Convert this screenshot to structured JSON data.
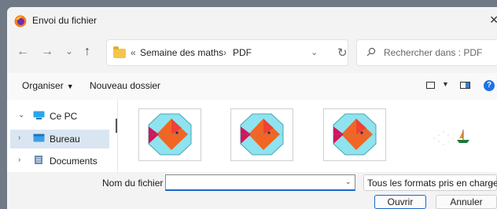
{
  "window": {
    "title": "Envoi du fichier",
    "close_icon": "close-icon"
  },
  "navigation": {
    "back_icon": "←",
    "forward_icon": "→",
    "recent_icon": "⌄",
    "up_icon": "↑"
  },
  "address": {
    "overflow": "«",
    "path": [
      "Semaine des maths",
      "PDF"
    ],
    "separator": "›"
  },
  "search": {
    "placeholder": "Rechercher dans : PDF"
  },
  "toolbar": {
    "organize_label": "Organiser",
    "new_folder_label": "Nouveau dossier",
    "caret": "▼",
    "help_label": "?"
  },
  "sidebar": {
    "items": [
      {
        "label": "Ce PC",
        "arrow": "⌄",
        "icon": "computer-icon"
      },
      {
        "label": "Bureau",
        "arrow": "›",
        "icon": "desktop-folder-icon"
      },
      {
        "label": "Documents",
        "arrow": "›",
        "icon": "documents-icon"
      }
    ]
  },
  "files": [
    {
      "thumbnail": "fish-polygon-thumbnail"
    },
    {
      "thumbnail": "fish-polygon-thumbnail"
    },
    {
      "thumbnail": "fish-polygon-thumbnail"
    },
    {
      "thumbnail": "boat-thumbnail"
    }
  ],
  "footer": {
    "filename_label": "Nom du fichier :",
    "filename_value": "",
    "filetype_value": "Tous les formats pris en charge",
    "open_label": "Ouvrir",
    "cancel_label": "Annuler"
  },
  "colors": {
    "accent": "#1a66c9",
    "folder": "#f4c54a",
    "selection": "#d9e6f2",
    "fish_orange": "#f26522",
    "fish_red": "#d4145a",
    "fish_bg_cyan": "#8fe3ee"
  }
}
